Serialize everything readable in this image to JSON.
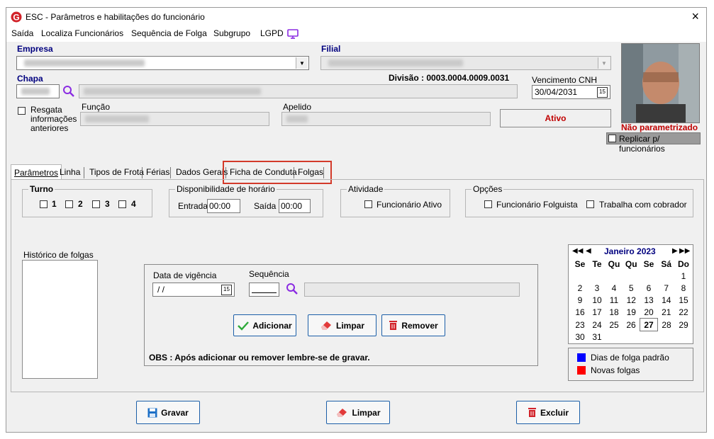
{
  "window": {
    "title": "ESC - Parâmetros e habilitações do funcionário",
    "close": "×"
  },
  "menu": [
    "Saída",
    "Localiza Funcionários",
    "Sequência de Folga",
    "Subgrupo",
    "LGPD"
  ],
  "form": {
    "empresa_label": "Empresa",
    "filial_label": "Filial",
    "chapa_label": "Chapa",
    "divisao": "Divisão : 0003.0004.0009.0031",
    "vencimento_label": "Vencimento  CNH",
    "vencimento_value": "30/04/2031",
    "resgata_label": "Resgata informações anteriores",
    "funcao_label": "Função",
    "apelido_label": "Apelido",
    "status": "Ativo",
    "photo_status": "Não parametrizado",
    "replicar_label": "Replicar p/ funcionários"
  },
  "tabs": [
    "Parâmetros",
    "Linha",
    "Tipos de Frota",
    "Férias",
    "Dados Gerais",
    "Ficha de Conduta",
    "Folgas"
  ],
  "params": {
    "turno_title": "Turno",
    "turnos": [
      "1",
      "2",
      "3",
      "4"
    ],
    "disp_title": "Disponibilidade de horário",
    "entrada_label": "Entrada",
    "entrada_value": "00:00",
    "saida_label": "Saída",
    "saida_value": "00:00",
    "atividade_title": "Atividade",
    "func_ativo_label": "Funcionário Ativo",
    "opcoes_title": "Opções",
    "folguista_label": "Funcionário Folguista",
    "cobrador_label": "Trabalha com cobrador"
  },
  "folgas": {
    "historico_label": "Histórico de folgas",
    "vigencia_label": "Data de vigência",
    "vigencia_value": " / /",
    "sequencia_label": "Sequência",
    "adicionar": "Adicionar",
    "limpar": "Limpar",
    "remover": "Remover",
    "obs": "OBS : Após adicionar ou  remover lembre-se de gravar."
  },
  "calendar": {
    "title": "Janeiro 2023",
    "weekdays": [
      "Se",
      "Te",
      "Qu",
      "Qu",
      "Se",
      "Sá",
      "Do"
    ],
    "weeks": [
      [
        "",
        "",
        "",
        "",
        "",
        "",
        "1"
      ],
      [
        "2",
        "3",
        "4",
        "5",
        "6",
        "7",
        "8"
      ],
      [
        "9",
        "10",
        "11",
        "12",
        "13",
        "14",
        "15"
      ],
      [
        "16",
        "17",
        "18",
        "19",
        "20",
        "21",
        "22"
      ],
      [
        "23",
        "24",
        "25",
        "26",
        "27",
        "28",
        "29"
      ],
      [
        "30",
        "31",
        "",
        "",
        "",
        "",
        ""
      ]
    ],
    "today": "27",
    "legend_padrao": "Dias de folga padrão",
    "legend_novas": "Novas folgas",
    "color_padrao": "#0000ff",
    "color_novas": "#ff0000"
  },
  "bottom": {
    "gravar": "Gravar",
    "limpar": "Limpar",
    "excluir": "Excluir"
  },
  "colors": {
    "status_red": "#c00000",
    "highlight_box": "#d33a2a",
    "label_blue": "#00007f",
    "accent_purple": "#8a2be2"
  }
}
